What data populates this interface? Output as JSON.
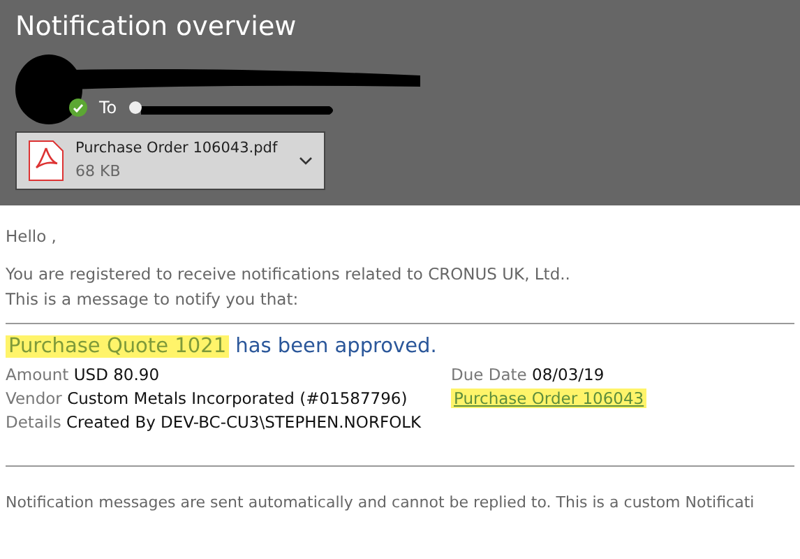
{
  "window": {
    "title": "Notification overview"
  },
  "message": {
    "to_label": "To",
    "sender_verified": true,
    "attachment": {
      "name": "Purchase Order 106043.pdf",
      "size": "68 KB"
    }
  },
  "body": {
    "greeting": "Hello ,",
    "intro": [
      "You are registered to receive notifications related to CRONUS UK, Ltd..",
      "This is a message to notify you that:"
    ],
    "heading": {
      "subject": "Purchase Quote 1021",
      "highlighted": true,
      "rest": "has been approved."
    },
    "fields_left": [
      {
        "label": "Amount",
        "value": "USD 80.90"
      },
      {
        "label": "Vendor",
        "value": "Custom Metals Incorporated (#01587796)"
      },
      {
        "label": "Details",
        "value": "Created By DEV-BC-CU3\\STEPHEN.NORFOLK"
      }
    ],
    "fields_right": [
      {
        "kind": "field",
        "label": "Due Date",
        "value": "08/03/19"
      },
      {
        "kind": "link",
        "text": "Purchase Order 106043",
        "highlighted": true
      }
    ],
    "footer": "Notification messages are sent automatically and cannot be replied to. This is a custom Notificati"
  }
}
